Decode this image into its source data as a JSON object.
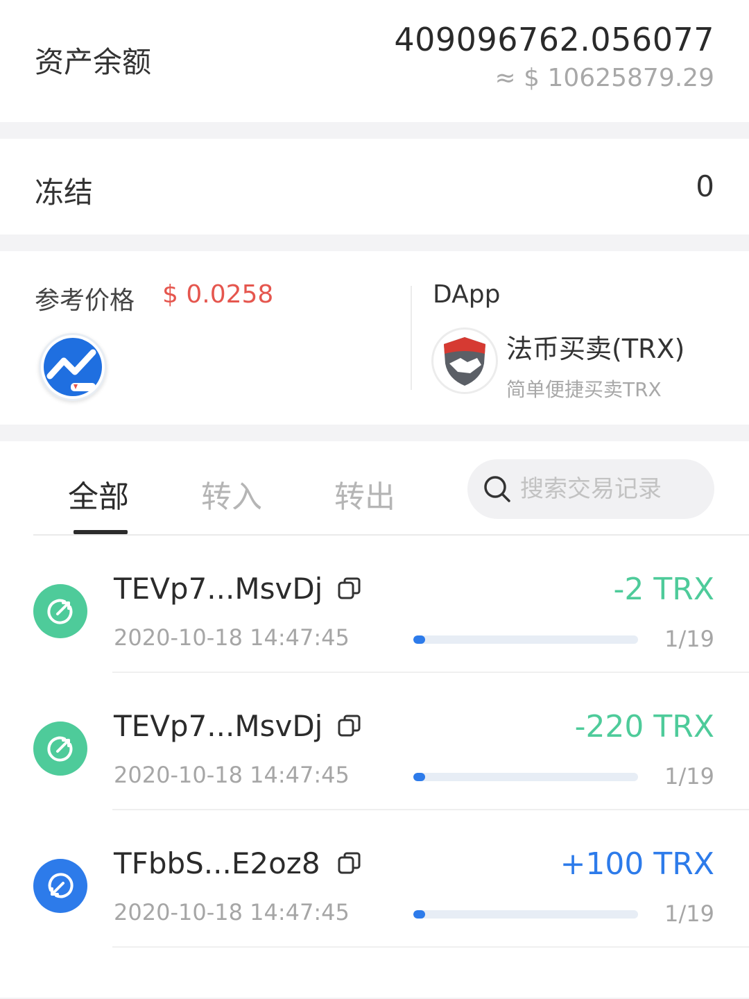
{
  "balance": {
    "label": "资产余额",
    "amount": "409096762.056077",
    "fiat": "≈ $ 10625879.29"
  },
  "frozen": {
    "label": "冻结",
    "value": "0"
  },
  "price": {
    "label": "参考价格",
    "value": "$ 0.0258",
    "icon": "chart-trend-icon"
  },
  "dapp": {
    "title": "DApp",
    "name": "法币买卖(TRX)",
    "desc": "简单便捷买卖TRX",
    "icon": "handshake-shield-icon"
  },
  "tabs": {
    "all": "全部",
    "in": "转入",
    "out": "转出"
  },
  "search": {
    "placeholder": "搜索交易记录"
  },
  "colors": {
    "out": "#4ecb9a",
    "in": "#2d7bea",
    "price": "#e5564e"
  },
  "transactions": [
    {
      "address": "TEVp7...MsvDj",
      "time": "2020-10-18 14:47:45",
      "amount": "-2 TRX",
      "progress": "1/19",
      "progress_value": 0.0526,
      "direction": "out"
    },
    {
      "address": "TEVp7...MsvDj",
      "time": "2020-10-18 14:47:45",
      "amount": "-220 TRX",
      "progress": "1/19",
      "progress_value": 0.0526,
      "direction": "out"
    },
    {
      "address": "TFbbS...E2oz8",
      "time": "2020-10-18 14:47:45",
      "amount": "+100 TRX",
      "progress": "1/19",
      "progress_value": 0.0526,
      "direction": "in"
    }
  ]
}
